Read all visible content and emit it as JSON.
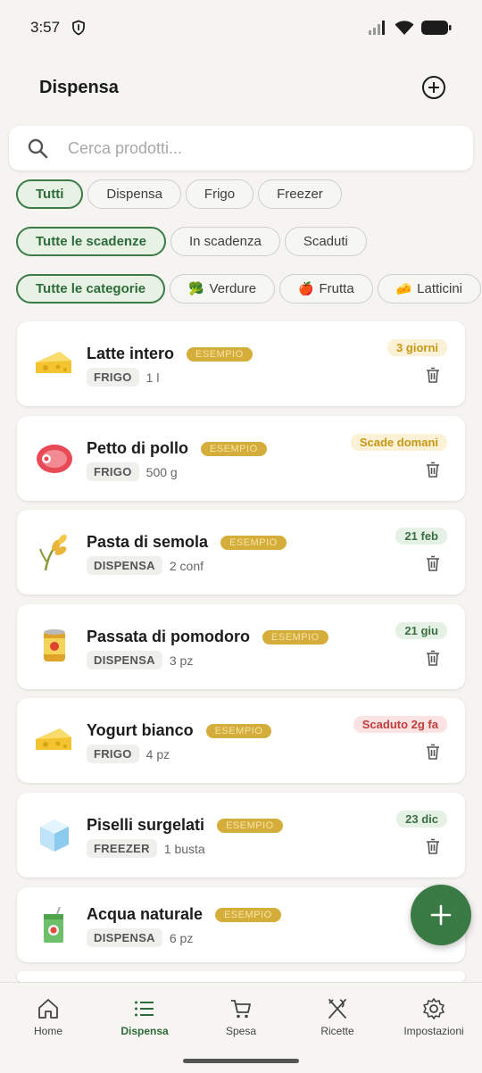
{
  "status_bar": {
    "time": "3:57"
  },
  "header": {
    "title": "Dispensa",
    "add_icon": "add-circle-icon"
  },
  "search": {
    "placeholder": "Cerca prodotti...",
    "value": ""
  },
  "location_filters": [
    "Tutti",
    "Dispensa",
    "Frigo",
    "Freezer"
  ],
  "expiry_filters": [
    "Tutte le scadenze",
    "In scadenza",
    "Scaduti"
  ],
  "category_filters": [
    {
      "label": "Tutte le categorie",
      "emoji": ""
    },
    {
      "label": "Verdure",
      "emoji": "🥦"
    },
    {
      "label": "Frutta",
      "emoji": "🍎"
    },
    {
      "label": "Latticini",
      "emoji": "🧀"
    }
  ],
  "active_filters": {
    "location": "Tutti",
    "expiry": "Tutte le scadenze",
    "category": "Tutte le categorie"
  },
  "items": [
    {
      "name": "Latte intero",
      "tag": "ESEMPIO",
      "location": "FRIGO",
      "qty": "1 l",
      "expiry": "3 giorni",
      "expiry_status": "warning",
      "icon": "cheese-icon"
    },
    {
      "name": "Petto di pollo",
      "tag": "ESEMPIO",
      "location": "FRIGO",
      "qty": "500 g",
      "expiry": "Scade domani",
      "expiry_status": "warning",
      "icon": "meat-icon"
    },
    {
      "name": "Pasta di semola",
      "tag": "ESEMPIO",
      "location": "DISPENSA",
      "qty": "2 conf",
      "expiry": "21 feb",
      "expiry_status": "ok",
      "icon": "wheat-icon"
    },
    {
      "name": "Passata di pomodoro",
      "tag": "ESEMPIO",
      "location": "DISPENSA",
      "qty": "3 pz",
      "expiry": "21 giu",
      "expiry_status": "ok",
      "icon": "canned-food-icon"
    },
    {
      "name": "Yogurt bianco",
      "tag": "ESEMPIO",
      "location": "FRIGO",
      "qty": "4 pz",
      "expiry": "Scaduto 2g fa",
      "expiry_status": "expired",
      "icon": "cheese-icon"
    },
    {
      "name": "Piselli surgelati",
      "tag": "ESEMPIO",
      "location": "FREEZER",
      "qty": "1 busta",
      "expiry": "23 dic",
      "expiry_status": "ok",
      "icon": "ice-cube-icon"
    },
    {
      "name": "Acqua naturale",
      "tag": "ESEMPIO",
      "location": "DISPENSA",
      "qty": "6 pz",
      "expiry": "",
      "expiry_status": "",
      "icon": "juice-box-icon"
    }
  ],
  "bottom_nav": [
    {
      "label": "Home",
      "icon": "home-icon",
      "active": false
    },
    {
      "label": "Dispensa",
      "icon": "list-icon",
      "active": true
    },
    {
      "label": "Spesa",
      "icon": "cart-icon",
      "active": false
    },
    {
      "label": "Ricette",
      "icon": "utensils-icon",
      "active": false
    },
    {
      "label": "Impostazioni",
      "icon": "gear-icon",
      "active": false
    }
  ],
  "colors": {
    "accent": "#3a7a45",
    "background": "#f5f4f0",
    "esempio": "#d4ad3a",
    "expired": "#c43c3c"
  }
}
